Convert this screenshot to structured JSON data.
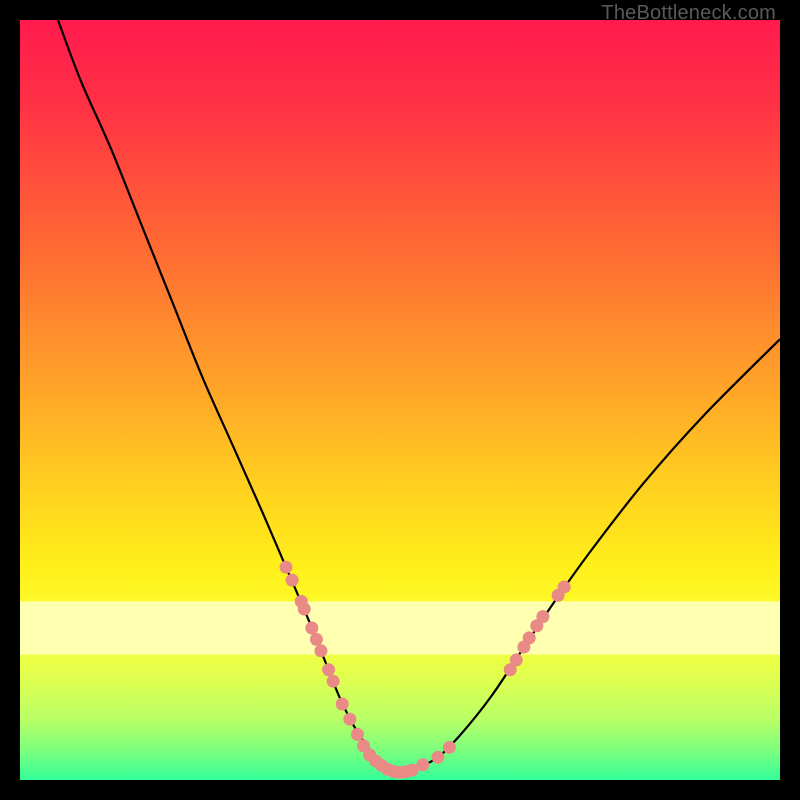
{
  "attribution": "TheBottleneck.com",
  "chart_data": {
    "type": "line",
    "title": "",
    "xlabel": "",
    "ylabel": "",
    "xlim": [
      0,
      100
    ],
    "ylim": [
      0,
      100
    ],
    "background_gradient_stops": [
      {
        "offset": 0.0,
        "color": "#ff1a4d"
      },
      {
        "offset": 0.12,
        "color": "#ff3344"
      },
      {
        "offset": 0.3,
        "color": "#ff6a33"
      },
      {
        "offset": 0.48,
        "color": "#ffa329"
      },
      {
        "offset": 0.62,
        "color": "#ffd21f"
      },
      {
        "offset": 0.72,
        "color": "#fff01a"
      },
      {
        "offset": 0.8,
        "color": "#fbff33"
      },
      {
        "offset": 0.86,
        "color": "#e4ff4d"
      },
      {
        "offset": 0.92,
        "color": "#b9ff66"
      },
      {
        "offset": 0.96,
        "color": "#7dff7d"
      },
      {
        "offset": 1.0,
        "color": "#33ff99"
      }
    ],
    "pale_yellow_band": {
      "y_top_fraction": 0.765,
      "y_bottom_fraction": 0.835,
      "color": "#ffffb0"
    },
    "series": [
      {
        "name": "bottleneck-curve",
        "color": "#000000",
        "stroke_width": 2.2,
        "x": [
          5,
          8,
          12,
          16,
          20,
          24,
          28,
          32,
          35,
          38,
          40,
          42,
          44,
          46,
          48,
          50,
          52,
          55,
          58,
          62,
          66,
          70,
          75,
          82,
          90,
          100
        ],
        "y": [
          100,
          92,
          83,
          73,
          63,
          53,
          44,
          35,
          28,
          21,
          16,
          11,
          7,
          4,
          2,
          1,
          1.5,
          3,
          6,
          11,
          17,
          23,
          30,
          39,
          48,
          58
        ]
      }
    ],
    "marker_clusters": [
      {
        "name": "left-segment-dots",
        "color": "#e98a86",
        "radius": 6.5,
        "points": [
          {
            "x": 35.0,
            "y": 28.0
          },
          {
            "x": 35.8,
            "y": 26.3
          },
          {
            "x": 37.0,
            "y": 23.5
          },
          {
            "x": 37.4,
            "y": 22.5
          },
          {
            "x": 38.4,
            "y": 20.0
          },
          {
            "x": 39.0,
            "y": 18.5
          },
          {
            "x": 39.6,
            "y": 17.0
          },
          {
            "x": 40.6,
            "y": 14.5
          },
          {
            "x": 41.2,
            "y": 13.0
          },
          {
            "x": 42.4,
            "y": 10.0
          },
          {
            "x": 43.4,
            "y": 8.0
          },
          {
            "x": 44.4,
            "y": 6.0
          }
        ]
      },
      {
        "name": "bottom-dots",
        "color": "#e98a86",
        "radius": 6.5,
        "points": [
          {
            "x": 45.2,
            "y": 4.5
          },
          {
            "x": 46.0,
            "y": 3.3
          },
          {
            "x": 46.8,
            "y": 2.5
          },
          {
            "x": 47.6,
            "y": 1.9
          },
          {
            "x": 48.4,
            "y": 1.4
          },
          {
            "x": 49.2,
            "y": 1.1
          },
          {
            "x": 50.0,
            "y": 1.0
          },
          {
            "x": 50.8,
            "y": 1.1
          },
          {
            "x": 51.6,
            "y": 1.3
          },
          {
            "x": 53.0,
            "y": 2.0
          },
          {
            "x": 55.0,
            "y": 3.0
          },
          {
            "x": 56.5,
            "y": 4.3
          }
        ]
      },
      {
        "name": "right-segment-dots",
        "color": "#e98a86",
        "radius": 6.5,
        "points": [
          {
            "x": 64.5,
            "y": 14.5
          },
          {
            "x": 65.3,
            "y": 15.8
          },
          {
            "x": 66.3,
            "y": 17.5
          },
          {
            "x": 67.0,
            "y": 18.7
          },
          {
            "x": 68.0,
            "y": 20.3
          },
          {
            "x": 68.8,
            "y": 21.5
          },
          {
            "x": 70.8,
            "y": 24.3
          },
          {
            "x": 71.6,
            "y": 25.4
          }
        ]
      }
    ]
  }
}
